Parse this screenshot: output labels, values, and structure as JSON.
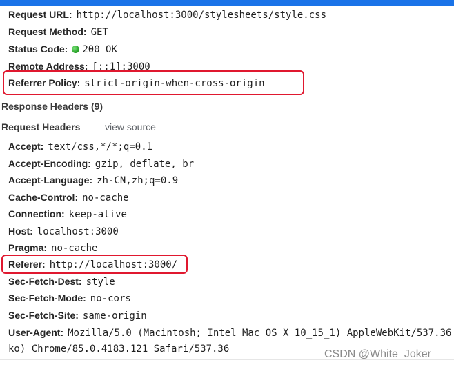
{
  "general": {
    "request_url": {
      "key": "Request URL:",
      "value": "http://localhost:3000/stylesheets/style.css"
    },
    "request_method": {
      "key": "Request Method:",
      "value": "GET"
    },
    "status_code": {
      "key": "Status Code:",
      "value": "200 OK",
      "status_color": "#2aa52a"
    },
    "remote_address": {
      "key": "Remote Address:",
      "value": "[::1]:3000"
    },
    "referrer_policy": {
      "key": "Referrer Policy:",
      "value": "strict-origin-when-cross-origin"
    }
  },
  "response_headers": {
    "title": "Response Headers (9)"
  },
  "request_headers": {
    "title": "Request Headers",
    "view_source": "view source",
    "accept": {
      "key": "Accept:",
      "value": "text/css,*/*;q=0.1"
    },
    "accept_encoding": {
      "key": "Accept-Encoding:",
      "value": "gzip, deflate, br"
    },
    "accept_language": {
      "key": "Accept-Language:",
      "value": "zh-CN,zh;q=0.9"
    },
    "cache_control": {
      "key": "Cache-Control:",
      "value": "no-cache"
    },
    "connection": {
      "key": "Connection:",
      "value": "keep-alive"
    },
    "host": {
      "key": "Host:",
      "value": "localhost:3000"
    },
    "pragma": {
      "key": "Pragma:",
      "value": "no-cache"
    },
    "referer": {
      "key": "Referer:",
      "value": "http://localhost:3000/"
    },
    "sec_fetch_dest": {
      "key": "Sec-Fetch-Dest:",
      "value": "style"
    },
    "sec_fetch_mode": {
      "key": "Sec-Fetch-Mode:",
      "value": "no-cors"
    },
    "sec_fetch_site": {
      "key": "Sec-Fetch-Site:",
      "value": "same-origin"
    },
    "user_agent": {
      "key": "User-Agent:",
      "value_line1": "Mozilla/5.0 (Macintosh; Intel Mac OS X 10_15_1) AppleWebKit/537.36",
      "value_line2": "ko) Chrome/85.0.4183.121 Safari/537.36"
    }
  },
  "watermark": "CSDN @White_Joker",
  "colors": {
    "highlight": "#e0182f",
    "topbar": "#1a73e8"
  }
}
